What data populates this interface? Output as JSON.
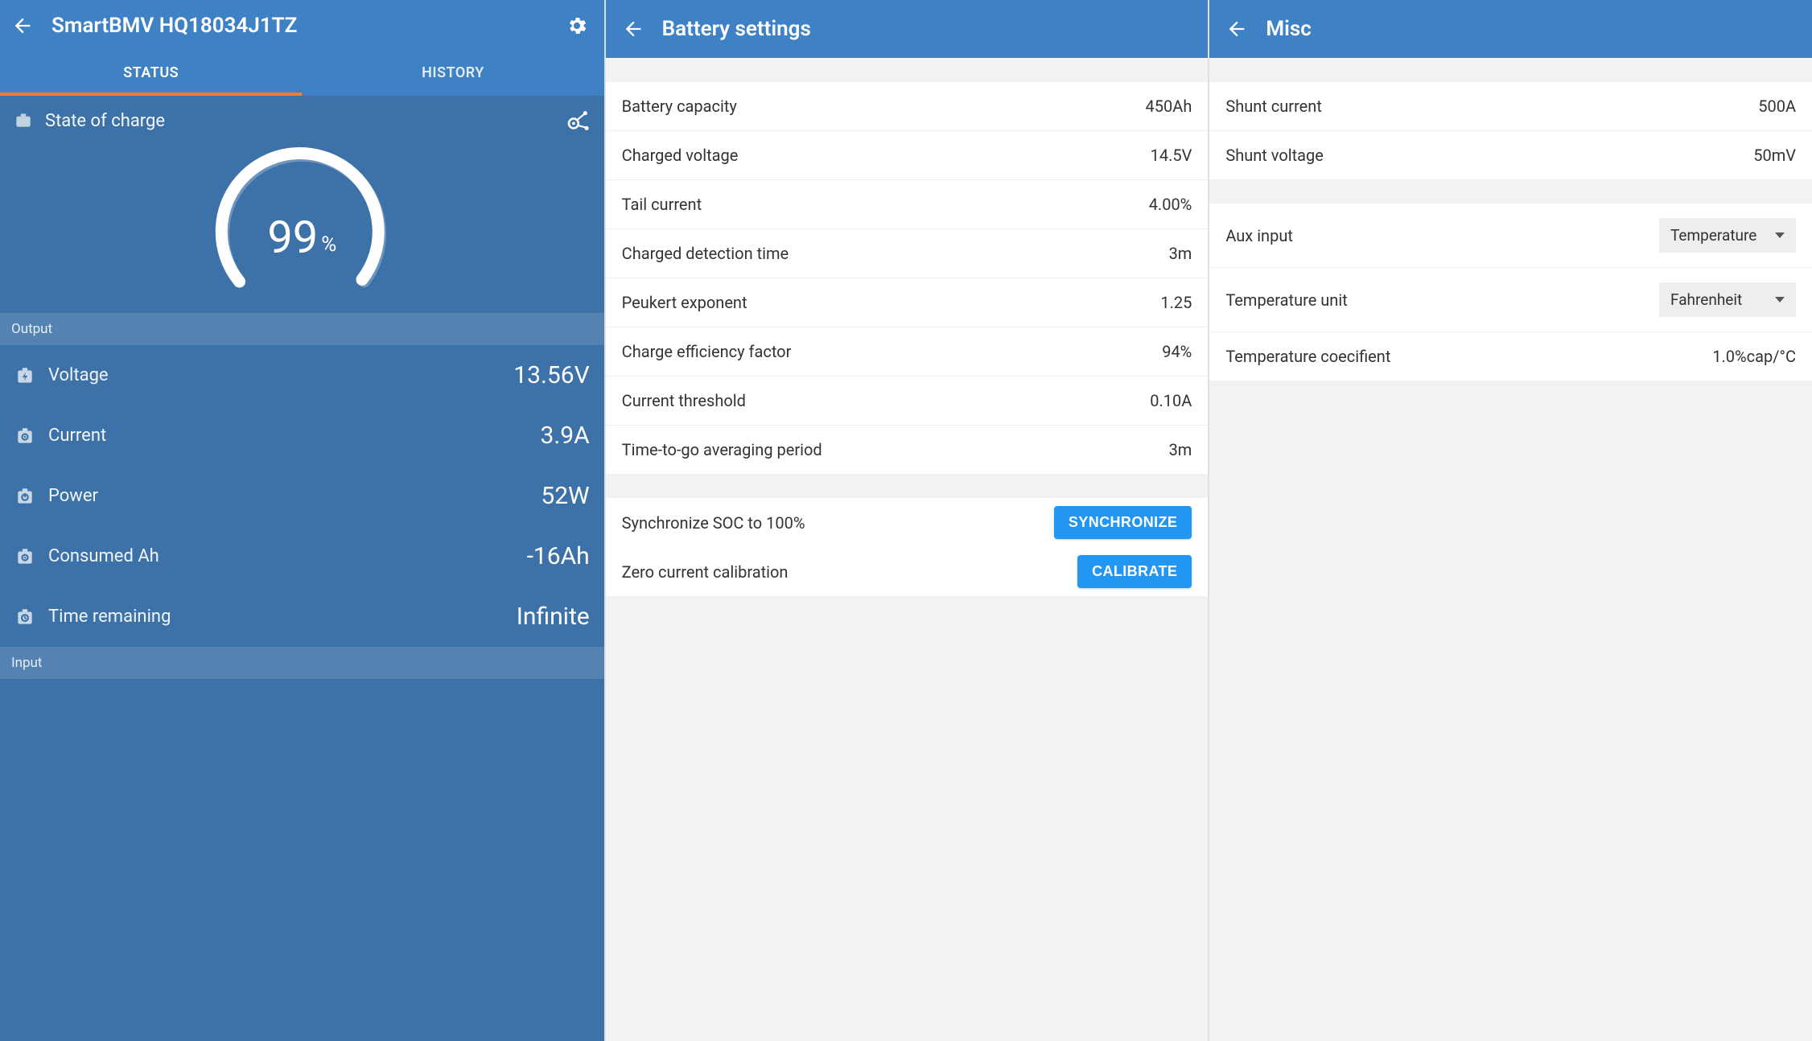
{
  "status": {
    "title": "SmartBMV HQ18034J1TZ",
    "tabs": {
      "status": "STATUS",
      "history": "HISTORY",
      "active": "status"
    },
    "soc": {
      "label": "State of charge",
      "value": "99",
      "unit": "%"
    },
    "sections": {
      "output": "Output",
      "input": "Input"
    },
    "metrics": [
      {
        "name": "voltage",
        "label": "Voltage",
        "value": "13.56V",
        "icon": "bolt"
      },
      {
        "name": "current",
        "label": "Current",
        "value": "3.9A",
        "icon": "target"
      },
      {
        "name": "power",
        "label": "Power",
        "value": "52W",
        "icon": "power"
      },
      {
        "name": "consumed-ah",
        "label": "Consumed Ah",
        "value": "-16Ah",
        "icon": "target"
      },
      {
        "name": "time-remaining",
        "label": "Time remaining",
        "value": "Infinite",
        "icon": "clock"
      }
    ]
  },
  "battery_settings": {
    "title": "Battery settings",
    "items": [
      {
        "name": "battery-capacity",
        "label": "Battery capacity",
        "value": "450Ah"
      },
      {
        "name": "charged-voltage",
        "label": "Charged voltage",
        "value": "14.5V"
      },
      {
        "name": "tail-current",
        "label": "Tail current",
        "value": "4.00%"
      },
      {
        "name": "charged-detection-time",
        "label": "Charged detection time",
        "value": "3m"
      },
      {
        "name": "peukert-exponent",
        "label": "Peukert exponent",
        "value": "1.25"
      },
      {
        "name": "charge-efficiency-factor",
        "label": "Charge efficiency factor",
        "value": "94%"
      },
      {
        "name": "current-threshold",
        "label": "Current threshold",
        "value": "0.10A"
      },
      {
        "name": "ttg-averaging-period",
        "label": "Time-to-go averaging period",
        "value": "3m"
      }
    ],
    "actions": [
      {
        "name": "synchronize-soc",
        "label": "Synchronize SOC to 100%",
        "button": "SYNCHRONIZE"
      },
      {
        "name": "zero-current-calibrate",
        "label": "Zero current calibration",
        "button": "CALIBRATE"
      }
    ]
  },
  "misc": {
    "title": "Misc",
    "group1": [
      {
        "name": "shunt-current",
        "label": "Shunt current",
        "value": "500A"
      },
      {
        "name": "shunt-voltage",
        "label": "Shunt voltage",
        "value": "50mV"
      }
    ],
    "group2": [
      {
        "name": "aux-input",
        "label": "Aux input",
        "type": "select",
        "value": "Temperature"
      },
      {
        "name": "temperature-unit",
        "label": "Temperature unit",
        "type": "select",
        "value": "Fahrenheit"
      },
      {
        "name": "temperature-coef",
        "label": "Temperature coecifient",
        "type": "value",
        "value": "1.0%cap/°C"
      }
    ]
  }
}
